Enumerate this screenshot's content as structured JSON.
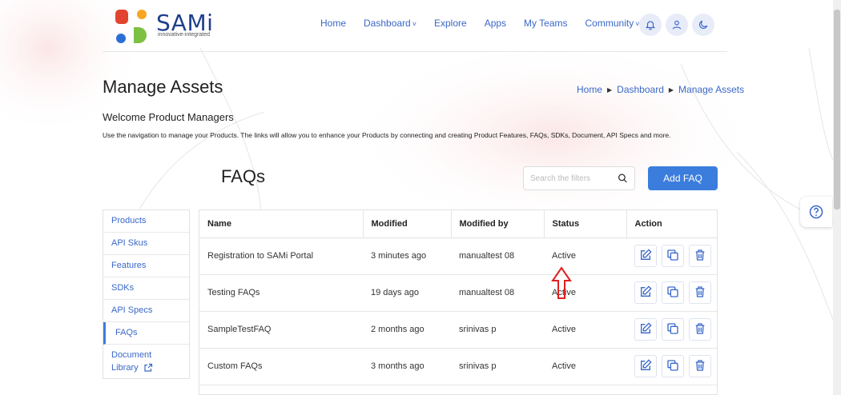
{
  "brand": {
    "name": "SAMi",
    "tagline": "innovative-integrated"
  },
  "nav": [
    {
      "label": "Home",
      "dropdown": false
    },
    {
      "label": "Dashboard",
      "dropdown": true
    },
    {
      "label": "Explore",
      "dropdown": false
    },
    {
      "label": "Apps",
      "dropdown": false
    },
    {
      "label": "My Teams",
      "dropdown": false
    },
    {
      "label": "Community",
      "dropdown": true
    }
  ],
  "header_icons": [
    "bell-icon",
    "user-icon",
    "moon-icon"
  ],
  "page": {
    "title": "Manage Assets",
    "breadcrumb": [
      "Home",
      "Dashboard",
      "Manage Assets"
    ],
    "welcome": "Welcome Product Managers",
    "description": "Use the navigation to manage your Products. The links will allow you to enhance your Products by connecting and creating Product Features, FAQs, SDKs, Document, API Specs and more."
  },
  "faq": {
    "title": "FAQs",
    "search_placeholder": "Search the filters",
    "add_label": "Add FAQ"
  },
  "side_menu": [
    {
      "label": "Products",
      "active": false
    },
    {
      "label": "API Skus",
      "active": false
    },
    {
      "label": "Features",
      "active": false
    },
    {
      "label": "SDKs",
      "active": false
    },
    {
      "label": "API Specs",
      "active": false
    },
    {
      "label": "FAQs",
      "active": true
    }
  ],
  "side_doc": {
    "line1": "Document",
    "line2": "Library"
  },
  "table": {
    "headers": [
      "Name",
      "Modified",
      "Modified by",
      "Status",
      "Action"
    ],
    "rows": [
      [
        "Registration to SAMi Portal",
        "3 minutes ago",
        "manualtest 08",
        "Active"
      ],
      [
        "Testing FAQs",
        "19 days ago",
        "manualtest 08",
        "Active"
      ],
      [
        "SampleTestFAQ",
        "2 months ago",
        "srinivas p",
        "Active"
      ],
      [
        "Custom FAQs",
        "3 months ago",
        "srinivas p",
        "Active"
      ]
    ]
  },
  "colors": {
    "accent": "#3b7ddd",
    "link": "#3a67c9",
    "logo_text": "#1f3f8c",
    "annotation": "#e02020"
  }
}
